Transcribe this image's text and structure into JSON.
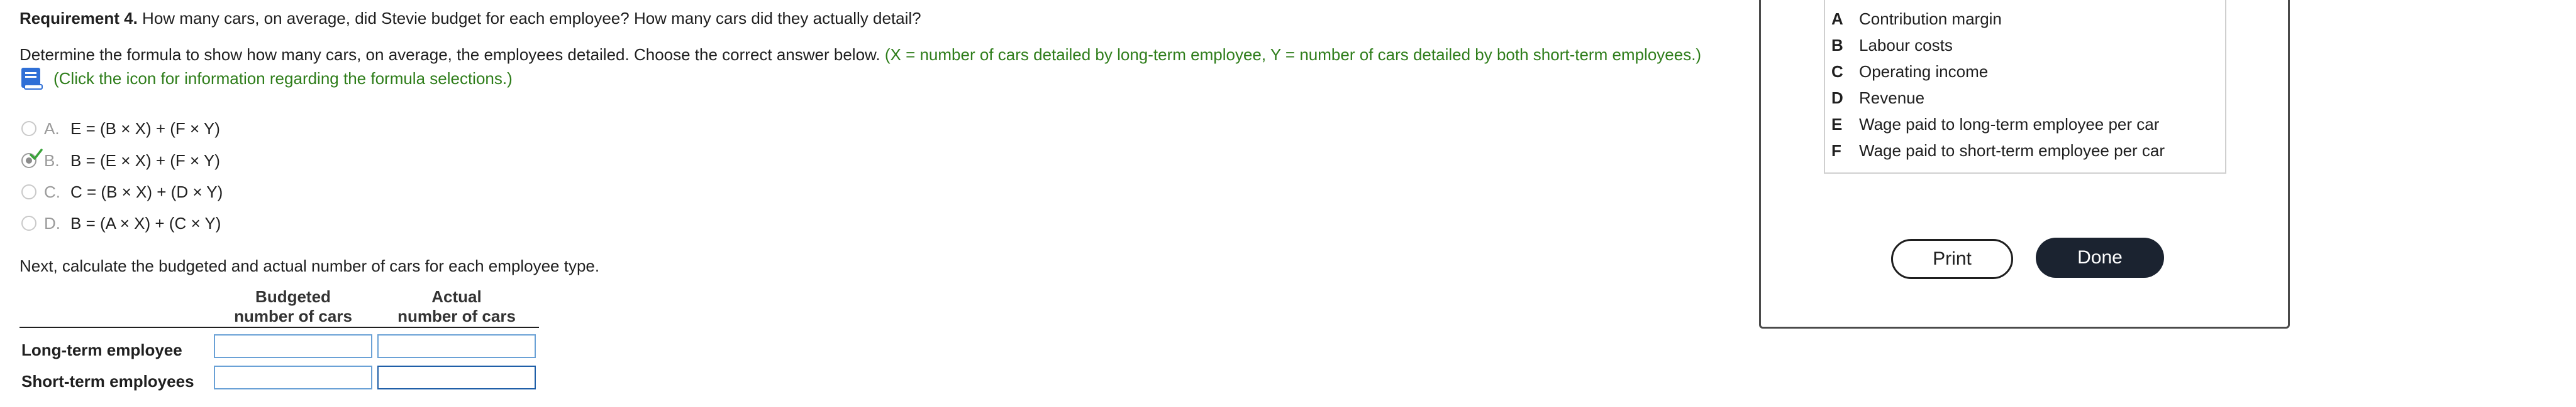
{
  "question": {
    "req_label": "Requirement 4.",
    "req_text": " How many cars, on average, did Stevie budget for each employee? How many cars did they actually detail?",
    "instruction": "Determine the formula to show how many cars, on average, the employees detailed. Choose the correct answer below.",
    "variables_note": "(X = number of cars detailed by long-term employee, Y = number of cars detailed by both short-term employees.)",
    "help_note": "(Click the icon for information regarding the formula selections.)",
    "help_icon": "book-icon"
  },
  "options": [
    {
      "letter": "A.",
      "text": "E = (B × X) + (F × Y)",
      "selected": false
    },
    {
      "letter": "B.",
      "text": "B = (E × X) + (F × Y)",
      "selected": true
    },
    {
      "letter": "C.",
      "text": "C = (B × X) + (D × Y)",
      "selected": false
    },
    {
      "letter": "D.",
      "text": "B = (A × X) + (C × Y)",
      "selected": false
    }
  ],
  "next_instruction": "Next, calculate the budgeted and actual number of cars for each employee type.",
  "table": {
    "col_budgeted_1": "Budgeted",
    "col_budgeted_2": "number of cars",
    "col_actual_1": "Actual",
    "col_actual_2": "number of cars",
    "rows": [
      {
        "label": "Long-term employee",
        "budgeted": "",
        "actual": ""
      },
      {
        "label": "Short-term employees",
        "budgeted": "",
        "actual": ""
      }
    ]
  },
  "legend": [
    {
      "key": "A",
      "text": "Contribution margin"
    },
    {
      "key": "B",
      "text": "Labour costs"
    },
    {
      "key": "C",
      "text": "Operating income"
    },
    {
      "key": "D",
      "text": "Revenue"
    },
    {
      "key": "E",
      "text": "Wage paid to long-term employee per car"
    },
    {
      "key": "F",
      "text": "Wage paid to short-term employee per car"
    }
  ],
  "buttons": {
    "print": "Print",
    "done": "Done"
  },
  "colors": {
    "note_green": "#2e7d1a",
    "done_bg": "#1b2330",
    "input_border": "#6aa1d6"
  }
}
